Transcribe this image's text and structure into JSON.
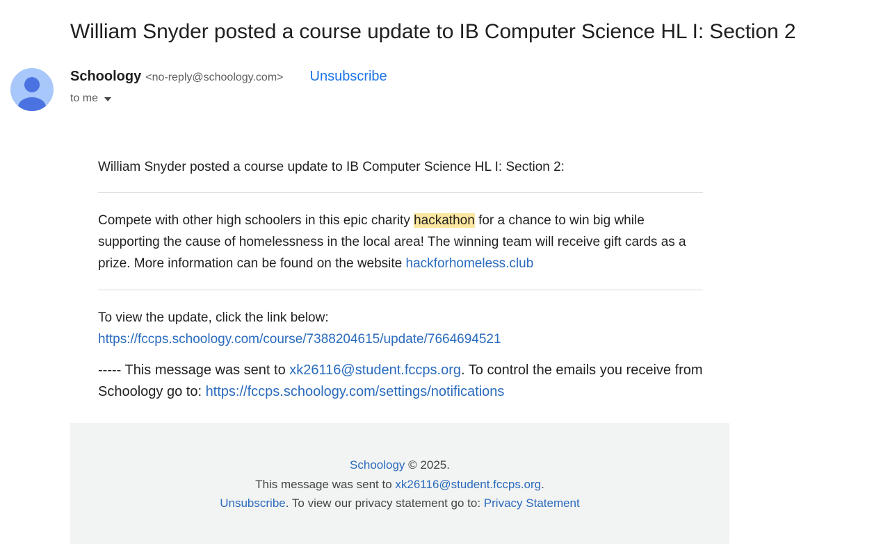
{
  "email": {
    "subject": "William Snyder posted a course update to IB Computer Science HL I: Section 2",
    "sender": {
      "name": "Schoology",
      "address": "<no-reply@schoology.com>",
      "unsubscribe_label": "Unsubscribe"
    },
    "recipient_label": "to me",
    "icons": {
      "avatar": "person-avatar-icon",
      "recipient_details": "caret-down-icon"
    },
    "colors": {
      "avatar_bg": "#a8c7fa",
      "avatar_fg": "#4a72e0",
      "link": "#2a6bbd",
      "highlight": "#fce7a0",
      "footer_bg": "#f2f3f3"
    }
  },
  "body": {
    "intro": "William Snyder posted a course update to IB Computer Science HL I: Section 2:",
    "announcement": {
      "part1": "Compete with other high schoolers in this epic charity ",
      "highlighted": "hackathon",
      "part2": " for a chance to win big while supporting the cause of homelessness in the local area!  The winning team will receive gift cards as a prize.   More information can be found on the website ",
      "link": "hackforhomeless.club"
    },
    "view_prompt": "To view the update, click the link below:",
    "update_link": "https://fccps.schoology.com/course/7388204615/update/7664694521",
    "notice": {
      "prefix": "----- This message was sent to ",
      "email": "xk26116@student.fccps.org",
      "middle": ". To control the emails you receive from Schoology go to: ",
      "settings_link": "https://fccps.schoology.com/settings/notifications"
    }
  },
  "footer": {
    "brand_link": "Schoology",
    "copyright": " © 2025.",
    "sent_prefix": "This message was sent to ",
    "sent_email": "xk26116@student.fccps.org",
    "sent_suffix": ".",
    "unsubscribe_link": "Unsubscribe",
    "privacy_text": ". To view our privacy statement go to: ",
    "privacy_link": "Privacy Statement"
  }
}
